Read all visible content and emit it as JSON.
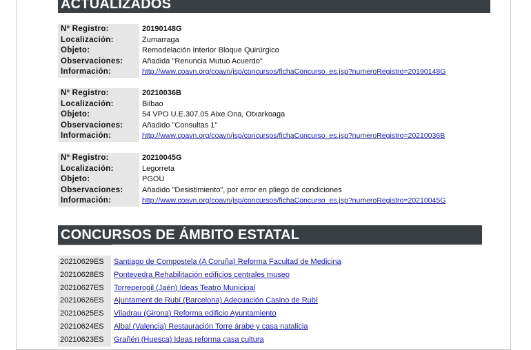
{
  "sections": {
    "top_banner": "ACTUALIZADOS",
    "estatal_banner": "CONCURSOS DE ÁMBITO ESTATAL"
  },
  "record_labels": {
    "registro": "Nº Registro:",
    "localizacion": "Localización:",
    "objeto": "Objeto:",
    "observaciones": "Observaciones:",
    "informacion": "Información:"
  },
  "records": [
    {
      "registro": "20190148G",
      "localizacion": "Zumarraga",
      "objeto": "Remodelación Interior Bloque Quirúrgico",
      "observaciones": "Añadida \"Renuncia Mutuo Acuerdo\"",
      "informacion": "http://www.coavn.org/coavn/jsp/concursos/fichaConcurso_es.jsp?numeroRegistro=20190148G"
    },
    {
      "registro": "20210036B",
      "localizacion": "Bilbao",
      "objeto": "54 VPO U.E.307.05 Aixe Ona, Otxarkoaga",
      "observaciones": "Añadido \"Consultas 1\"",
      "informacion": "http://www.coavn.org/coavn/jsp/concursos/fichaConcurso_es.jsp?numeroRegistro=20210036B"
    },
    {
      "registro": "20210045G",
      "localizacion": "Legorreta",
      "objeto": "PGOU",
      "observaciones": "Añadido \"Desistimiento\", por error en pliego de condiciones",
      "informacion": "http://www.coavn.org/coavn/jsp/concursos/fichaConcurso_es.jsp?numeroRegistro=20210045G"
    }
  ],
  "concursos_estatal": [
    {
      "id": "20210629ES",
      "title": "Santiago de Compostela (A Coruña) Reforma Facultad de Medicina"
    },
    {
      "id": "20210628ES",
      "title": "Pontevedra Rehabilitación edificios centrales museo"
    },
    {
      "id": "20210627ES",
      "title": "Torreperogil (Jaén) Ideas Teatro Municipal"
    },
    {
      "id": "20210626ES",
      "title": "Ajuntament de Rubí (Barcelona) Adecuación Casino de Rubí"
    },
    {
      "id": "20210625ES",
      "title": "Viladrau (Girona) Reforma edificio Ayuntamiento"
    },
    {
      "id": "20210624ES",
      "title": "Albal (Valencia) Restauración Torre árabe y casa natalicia "
    },
    {
      "id": "20210623ES",
      "title": "Grañén (Huesca) Ideas reforma casa cultura"
    }
  ]
}
